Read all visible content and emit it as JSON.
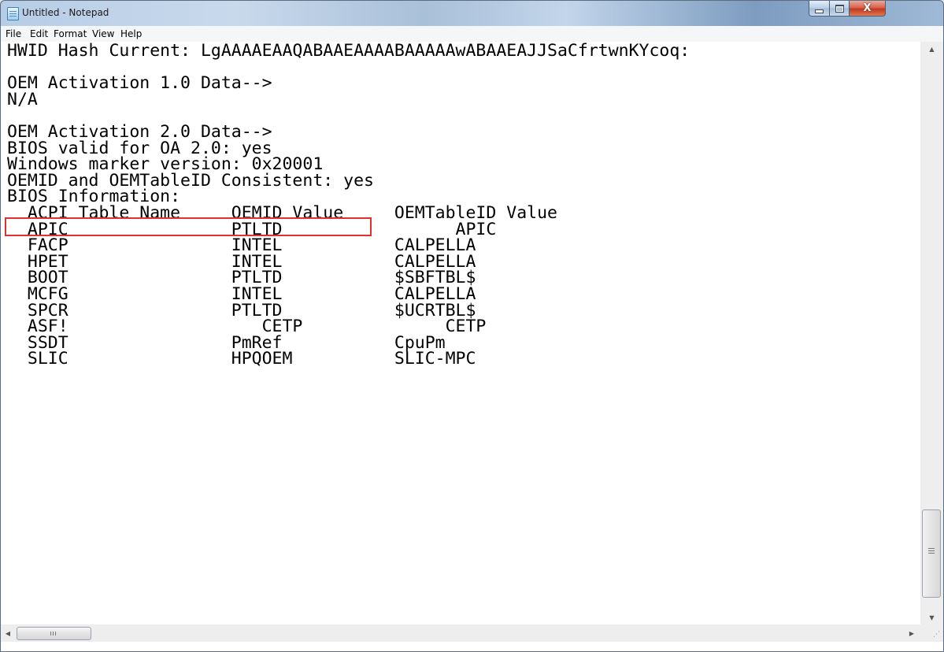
{
  "window": {
    "title": "Untitled - Notepad",
    "close_glyph": "X",
    "icon": "notepad-icon"
  },
  "menu": {
    "items": [
      "File",
      "Edit",
      "Format",
      "View",
      "Help"
    ]
  },
  "document": {
    "lines": [
      "HWID Hash Current: LgAAAAEAAQABAAEAAAABAAAAAwABAAEAJJSaCfrtwnKYcoq:",
      "",
      "OEM Activation 1.0 Data-->",
      "N/A",
      "",
      "OEM Activation 2.0 Data-->",
      "BIOS valid for OA 2.0: yes",
      "Windows marker version: 0x20001",
      "OEMID and OEMTableID Consistent: yes",
      "BIOS Information:",
      "  ACPI Table Name     OEMID Value     OEMTableID Value",
      "  APIC                PTLTD                 APIC",
      "  FACP                INTEL           CALPELLA",
      "  HPET                INTEL           CALPELLA",
      "  BOOT                PTLTD           $SBFTBL$",
      "  MCFG                INTEL           CALPELLA",
      "  SPCR                PTLTD           $UCRTBL$",
      "  ASF!                   CETP              CETP",
      "  SSDT                PmRef           CpuPm",
      "  SLIC                HPQOEM          SLIC-MPC"
    ],
    "highlighted_line": "BIOS valid for OA 2.0: yes",
    "highlight_color": "#e03030"
  },
  "scrollbars": {
    "vertical_position": 0.85,
    "horizontal_position": 0.0,
    "hthumb_grip": "III",
    "vthumb_grip": "≡"
  }
}
